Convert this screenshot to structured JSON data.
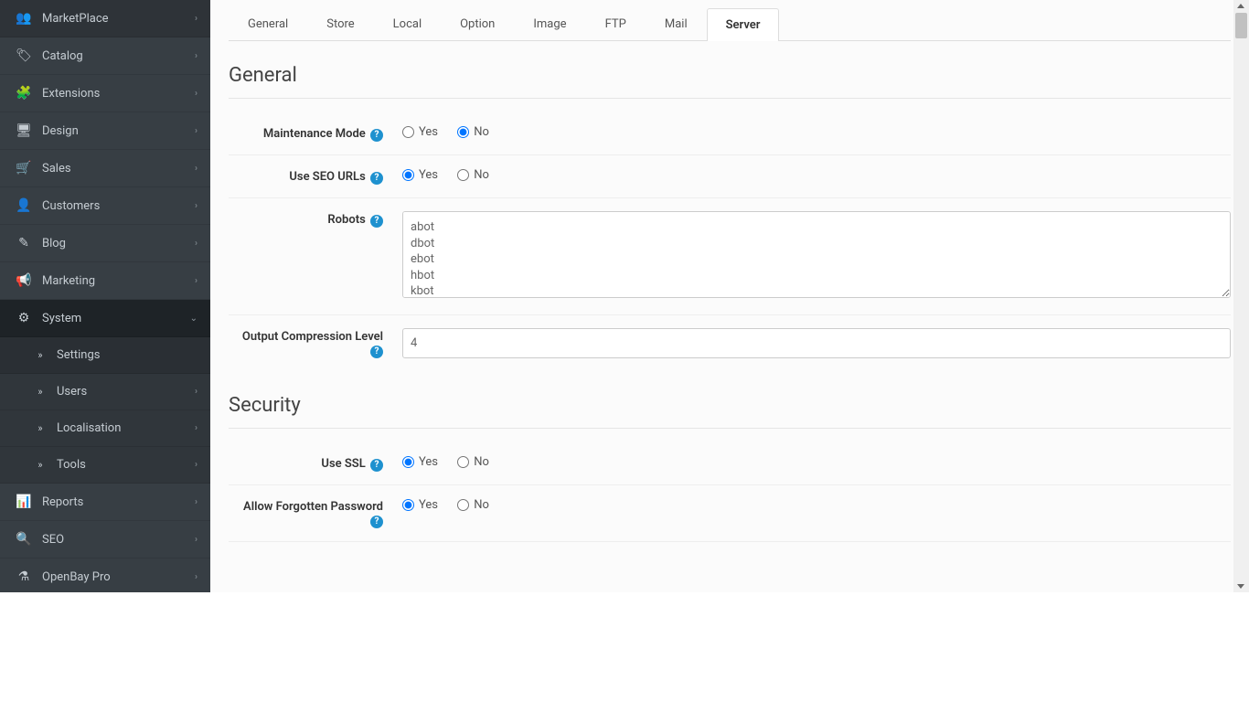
{
  "sidebar": {
    "items": [
      {
        "icon": "👥",
        "label": "MarketPlace"
      },
      {
        "icon": "🏷",
        "label": "Catalog"
      },
      {
        "icon": "🧩",
        "label": "Extensions"
      },
      {
        "icon": "🖥",
        "label": "Design"
      },
      {
        "icon": "🛒",
        "label": "Sales"
      },
      {
        "icon": "👤",
        "label": "Customers"
      },
      {
        "icon": "✎",
        "label": "Blog"
      },
      {
        "icon": "📢",
        "label": "Marketing"
      },
      {
        "icon": "⚙",
        "label": "System",
        "active": true
      },
      {
        "icon": "📊",
        "label": "Reports"
      },
      {
        "icon": "🔍",
        "label": "SEO"
      },
      {
        "icon": "⚗",
        "label": "OpenBay Pro"
      }
    ],
    "system_sub": [
      {
        "label": "Settings"
      },
      {
        "label": "Users"
      },
      {
        "label": "Localisation"
      },
      {
        "label": "Tools"
      }
    ]
  },
  "tabs": [
    "General",
    "Store",
    "Local",
    "Option",
    "Image",
    "FTP",
    "Mail",
    "Server"
  ],
  "active_tab": "Server",
  "sections": {
    "general": {
      "heading": "General",
      "maintenance": {
        "label": "Maintenance Mode",
        "value": "No"
      },
      "seo": {
        "label": "Use SEO URLs",
        "value": "Yes"
      },
      "robots": {
        "label": "Robots",
        "value": "abot\ndbot\nebot\nhbot\nkbot\nlbot"
      },
      "compression": {
        "label": "Output Compression Level",
        "value": "4"
      }
    },
    "security": {
      "heading": "Security",
      "ssl": {
        "label": "Use SSL",
        "value": "Yes"
      },
      "forgot": {
        "label": "Allow Forgotten Password",
        "value": "Yes"
      }
    },
    "yes": "Yes",
    "no": "No"
  }
}
